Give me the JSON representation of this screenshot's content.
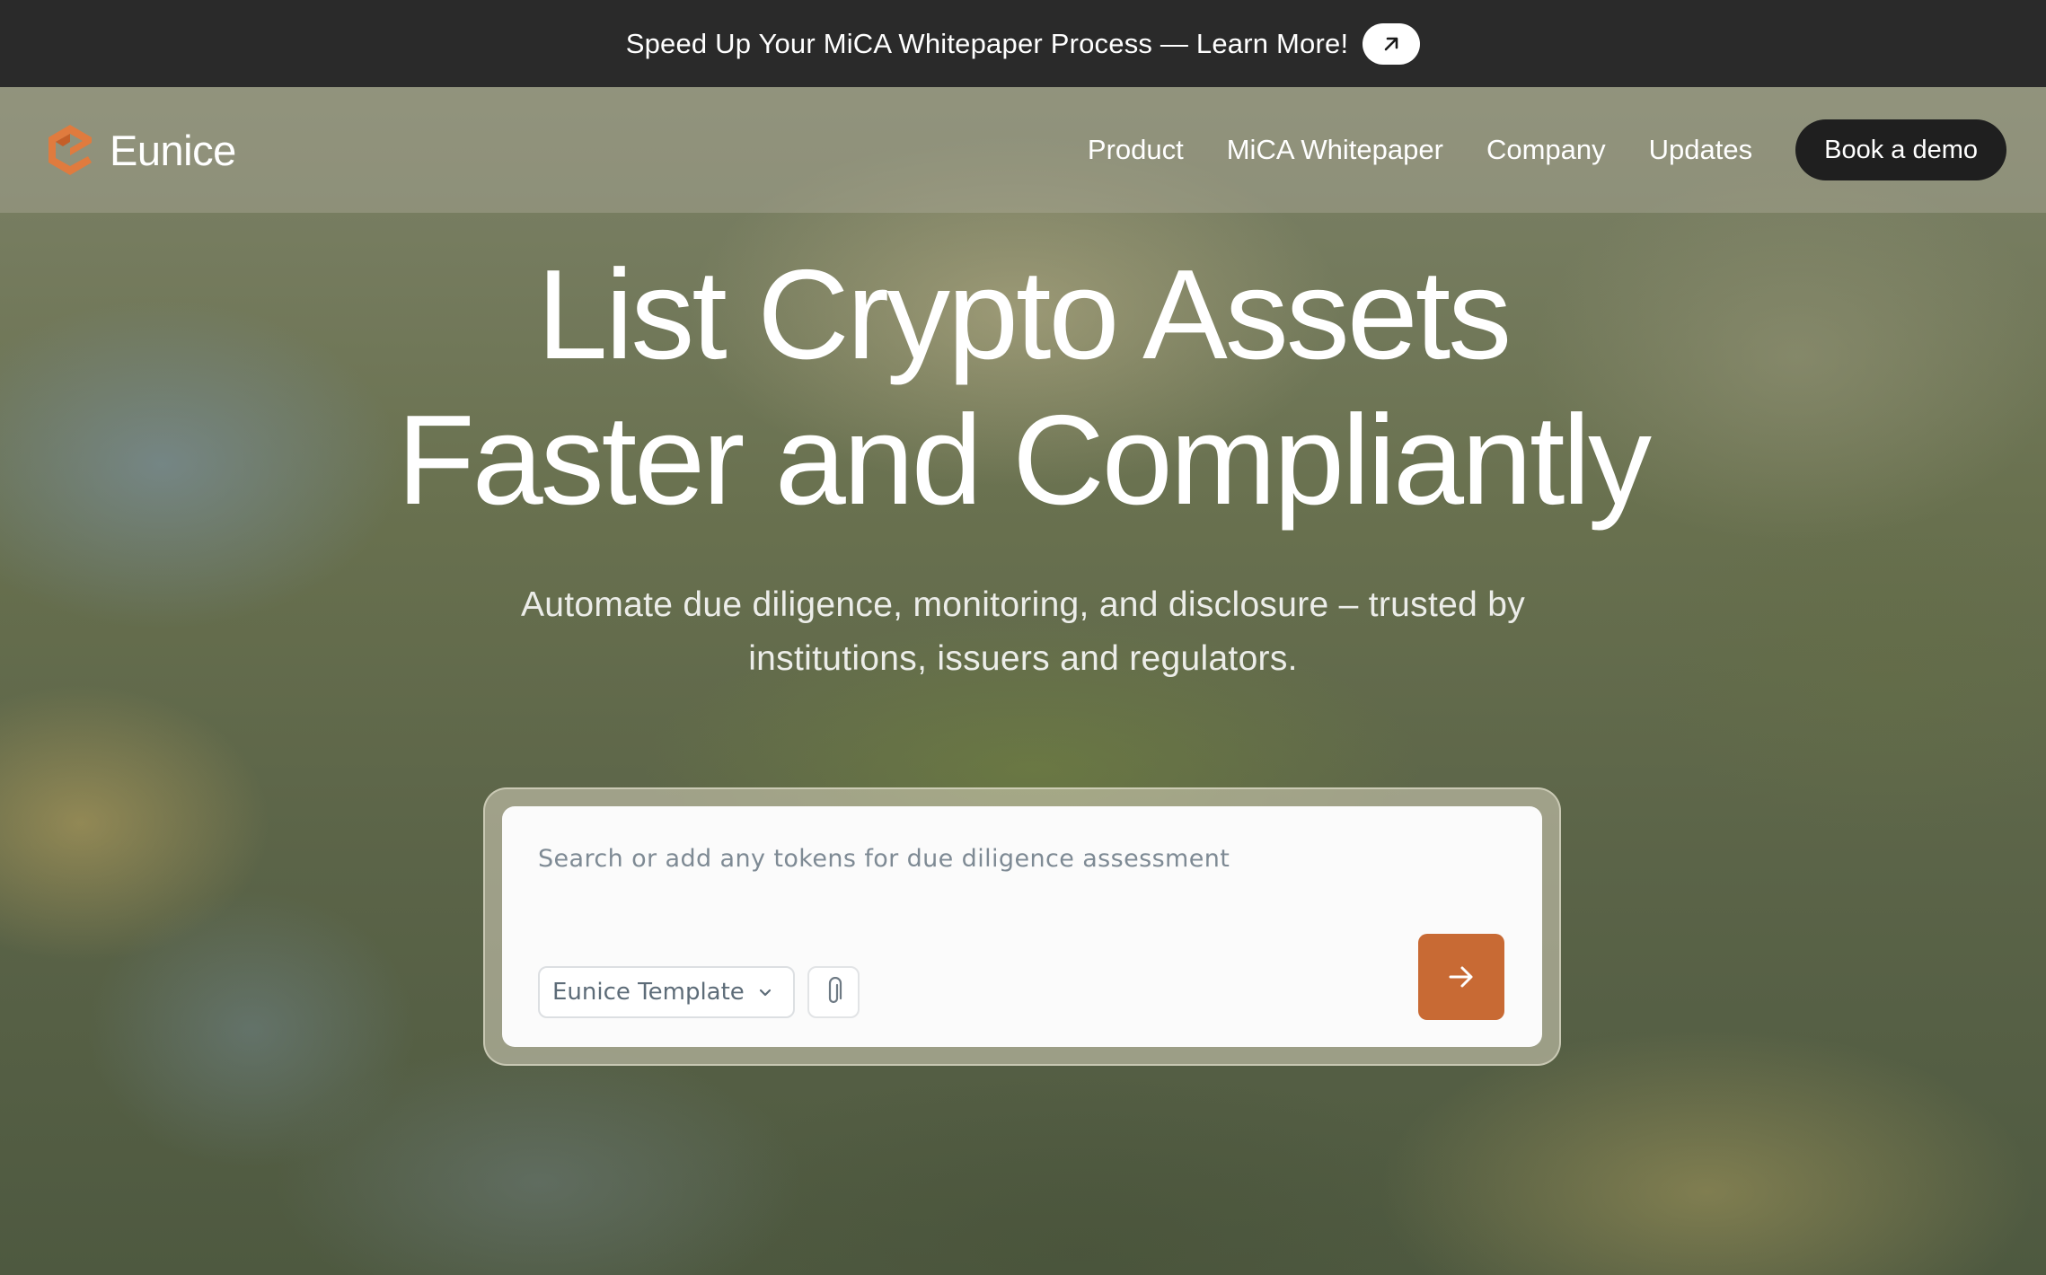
{
  "announcement": {
    "text": "Speed Up Your MiCA Whitepaper Process — Learn More!",
    "link_icon": "arrow-up-right-icon"
  },
  "nav": {
    "brand": "Eunice",
    "logo_icon": "eunice-logo-icon",
    "links": [
      "Product",
      "MiCA Whitepaper",
      "Company",
      "Updates"
    ],
    "cta": "Book a demo"
  },
  "hero": {
    "title_line1": "List Crypto Assets",
    "title_line2": "Faster and Compliantly",
    "subtitle_line1": "Automate due diligence, monitoring, and disclosure – trusted by",
    "subtitle_line2": "institutions, issuers and regulators."
  },
  "search": {
    "placeholder": "Search or add any tokens for due diligence assessment",
    "template_label": "Eunice Template",
    "template_icon": "chevron-down-icon",
    "attach_icon": "paperclip-icon",
    "submit_icon": "arrow-right-icon"
  },
  "colors": {
    "accent": "#c86a34",
    "logo": "#e07b3e",
    "announcement_bg": "#2a2a2a",
    "cta_bg": "#1f1f1f"
  }
}
